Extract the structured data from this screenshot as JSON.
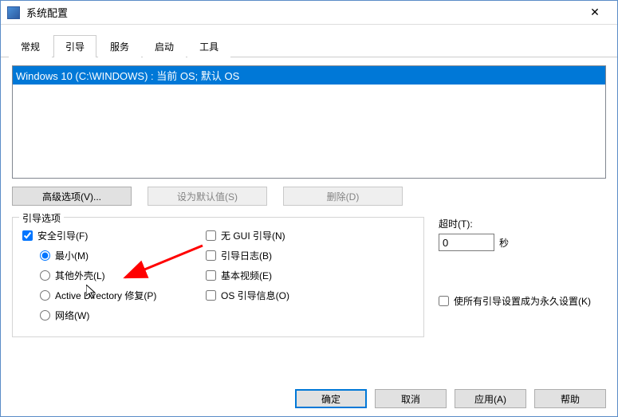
{
  "title": "系统配置",
  "tabs": [
    "常规",
    "引导",
    "服务",
    "启动",
    "工具"
  ],
  "activeTab": 1,
  "oslist": {
    "selected": "Windows 10 (C:\\WINDOWS) : 当前 OS; 默认 OS"
  },
  "buttons": {
    "advanced": "高级选项(V)...",
    "setdefault": "设为默认值(S)",
    "delete": "删除(D)"
  },
  "bootopts": {
    "legend": "引导选项",
    "safeboot": {
      "label": "安全引导(F)",
      "checked": true
    },
    "radios": {
      "min": "最小(M)",
      "shell": "其他外壳(L)",
      "ad": "Active Directory 修复(P)",
      "net": "网络(W)"
    },
    "radioSel": "min",
    "checks": {
      "nogui": "无 GUI 引导(N)",
      "log": "引导日志(B)",
      "video": "基本视频(E)",
      "osinfo": "OS 引导信息(O)"
    }
  },
  "timeout": {
    "label": "超时(T):",
    "value": "0",
    "unit": "秒"
  },
  "perm": {
    "label": "使所有引导设置成为永久设置(K)"
  },
  "footer": {
    "ok": "确定",
    "cancel": "取消",
    "apply": "应用(A)",
    "help": "帮助"
  }
}
